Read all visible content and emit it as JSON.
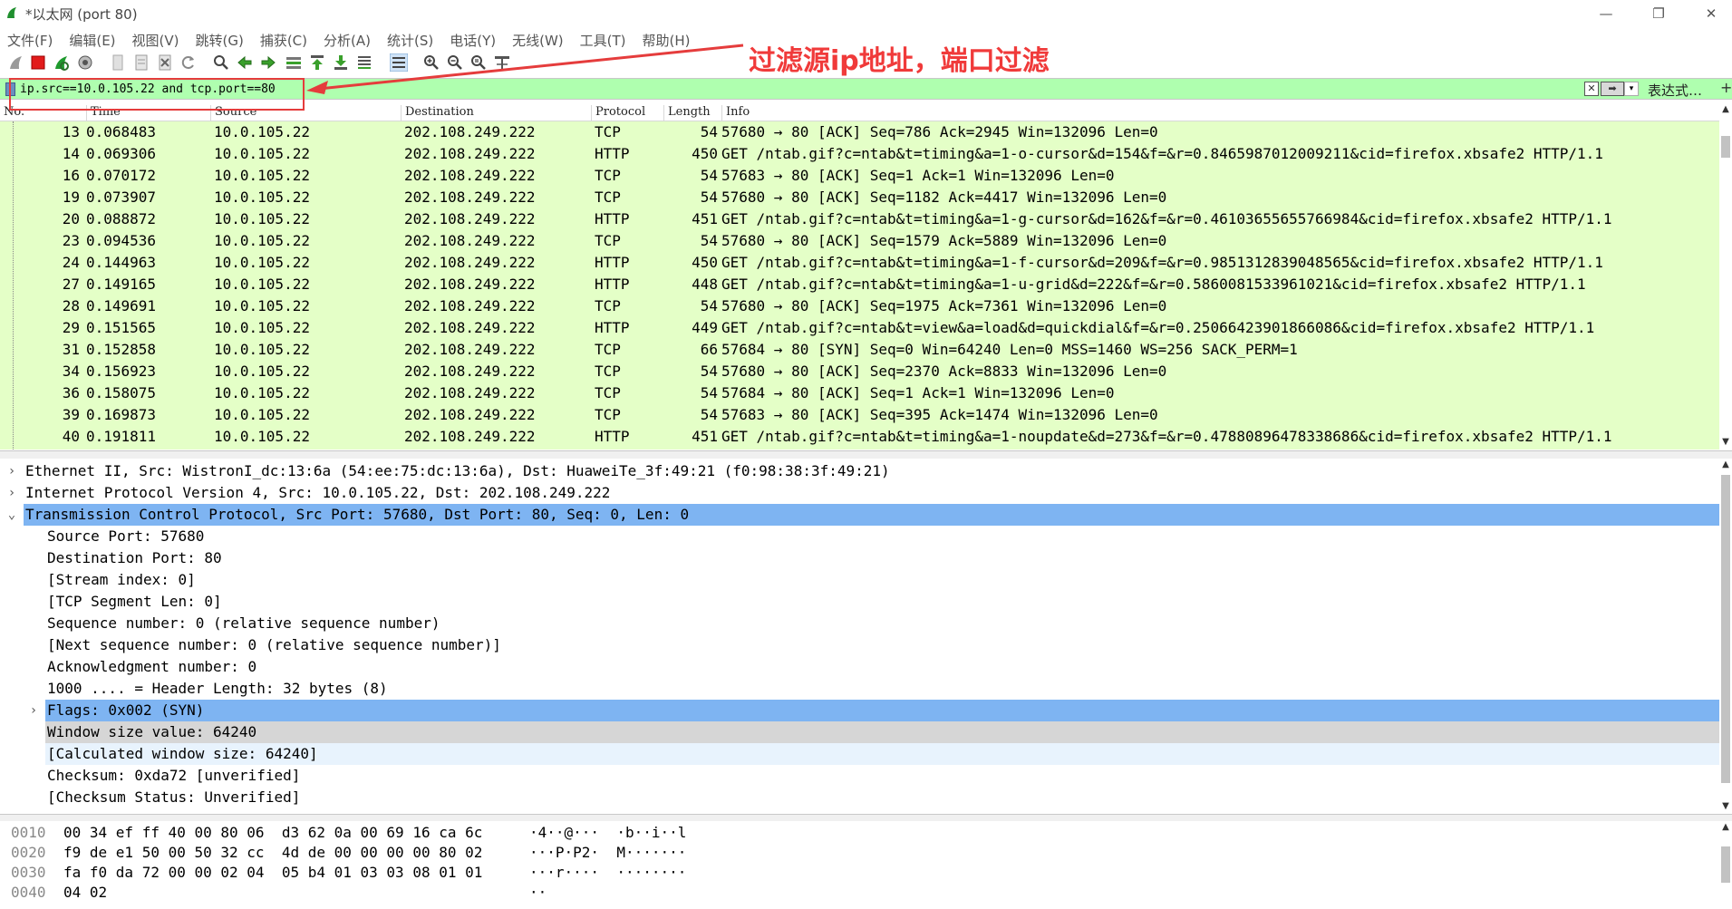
{
  "window": {
    "title": "*以太网 (port 80)",
    "minimize_glyph": "—",
    "maximize_glyph": "❐",
    "close_glyph": "✕"
  },
  "menu": [
    "文件(F)",
    "编辑(E)",
    "视图(V)",
    "跳转(G)",
    "捕获(C)",
    "分析(A)",
    "统计(S)",
    "电话(Y)",
    "无线(W)",
    "工具(T)",
    "帮助(H)"
  ],
  "toolbar": {
    "icons": [
      "shark-fin-start-icon",
      "stop-capture-icon",
      "restart-capture-icon",
      "capture-options-icon",
      "open-file-icon",
      "save-file-icon",
      "close-file-icon",
      "reload-file-icon",
      "find-packet-icon",
      "go-back-icon",
      "go-forward-icon",
      "go-to-packet-icon",
      "go-first-packet-icon",
      "go-last-packet-icon",
      "auto-scroll-icon",
      "colorize-icon",
      "zoom-in-icon",
      "zoom-out-icon",
      "zoom-normal-icon",
      "resize-columns-icon"
    ]
  },
  "filter": {
    "value": "ip.src==10.0.105.22 and tcp.port==80",
    "clear_glyph": "✕",
    "apply_glyph": "➡",
    "dropdown_glyph": "▾",
    "expression_label": "表达式…",
    "add_glyph": "+",
    "bg_color": "#afffaf"
  },
  "annotation": {
    "text": "过滤源ip地址，端口过滤",
    "color": "#f03a3a"
  },
  "packet_list": {
    "columns": [
      "No.",
      "Time",
      "Source",
      "Destination",
      "Protocol",
      "Length",
      "Info"
    ],
    "row_color": "#e4ffc7",
    "rows": [
      {
        "no": "13",
        "time": "0.068483",
        "src": "10.0.105.22",
        "dst": "202.108.249.222",
        "proto": "TCP",
        "len": "54",
        "info": "57680 → 80 [ACK] Seq=786 Ack=2945 Win=132096 Len=0"
      },
      {
        "no": "14",
        "time": "0.069306",
        "src": "10.0.105.22",
        "dst": "202.108.249.222",
        "proto": "HTTP",
        "len": "450",
        "info": "GET /ntab.gif?c=ntab&t=timing&a=1-o-cursor&d=154&f=&r=0.8465987012009211&cid=firefox.xbsafe2 HTTP/1.1"
      },
      {
        "no": "16",
        "time": "0.070172",
        "src": "10.0.105.22",
        "dst": "202.108.249.222",
        "proto": "TCP",
        "len": "54",
        "info": "57683 → 80 [ACK] Seq=1 Ack=1 Win=132096 Len=0"
      },
      {
        "no": "19",
        "time": "0.073907",
        "src": "10.0.105.22",
        "dst": "202.108.249.222",
        "proto": "TCP",
        "len": "54",
        "info": "57680 → 80 [ACK] Seq=1182 Ack=4417 Win=132096 Len=0"
      },
      {
        "no": "20",
        "time": "0.088872",
        "src": "10.0.105.22",
        "dst": "202.108.249.222",
        "proto": "HTTP",
        "len": "451",
        "info": "GET /ntab.gif?c=ntab&t=timing&a=1-g-cursor&d=162&f=&r=0.46103655655766984&cid=firefox.xbsafe2 HTTP/1.1"
      },
      {
        "no": "23",
        "time": "0.094536",
        "src": "10.0.105.22",
        "dst": "202.108.249.222",
        "proto": "TCP",
        "len": "54",
        "info": "57680 → 80 [ACK] Seq=1579 Ack=5889 Win=132096 Len=0"
      },
      {
        "no": "24",
        "time": "0.144963",
        "src": "10.0.105.22",
        "dst": "202.108.249.222",
        "proto": "HTTP",
        "len": "450",
        "info": "GET /ntab.gif?c=ntab&t=timing&a=1-f-cursor&d=209&f=&r=0.9851312839048565&cid=firefox.xbsafe2 HTTP/1.1"
      },
      {
        "no": "27",
        "time": "0.149165",
        "src": "10.0.105.22",
        "dst": "202.108.249.222",
        "proto": "HTTP",
        "len": "448",
        "info": "GET /ntab.gif?c=ntab&t=timing&a=1-u-grid&d=222&f=&r=0.5860081533961021&cid=firefox.xbsafe2 HTTP/1.1"
      },
      {
        "no": "28",
        "time": "0.149691",
        "src": "10.0.105.22",
        "dst": "202.108.249.222",
        "proto": "TCP",
        "len": "54",
        "info": "57680 → 80 [ACK] Seq=1975 Ack=7361 Win=132096 Len=0"
      },
      {
        "no": "29",
        "time": "0.151565",
        "src": "10.0.105.22",
        "dst": "202.108.249.222",
        "proto": "HTTP",
        "len": "449",
        "info": "GET /ntab.gif?c=ntab&t=view&a=load&d=quickdial&f=&r=0.25066423901866086&cid=firefox.xbsafe2 HTTP/1.1"
      },
      {
        "no": "31",
        "time": "0.152858",
        "src": "10.0.105.22",
        "dst": "202.108.249.222",
        "proto": "TCP",
        "len": "66",
        "info": "57684 → 80 [SYN] Seq=0 Win=64240 Len=0 MSS=1460 WS=256 SACK_PERM=1"
      },
      {
        "no": "34",
        "time": "0.156923",
        "src": "10.0.105.22",
        "dst": "202.108.249.222",
        "proto": "TCP",
        "len": "54",
        "info": "57680 → 80 [ACK] Seq=2370 Ack=8833 Win=132096 Len=0"
      },
      {
        "no": "36",
        "time": "0.158075",
        "src": "10.0.105.22",
        "dst": "202.108.249.222",
        "proto": "TCP",
        "len": "54",
        "info": "57684 → 80 [ACK] Seq=1 Ack=1 Win=132096 Len=0"
      },
      {
        "no": "39",
        "time": "0.169873",
        "src": "10.0.105.22",
        "dst": "202.108.249.222",
        "proto": "TCP",
        "len": "54",
        "info": "57683 → 80 [ACK] Seq=395 Ack=1474 Win=132096 Len=0"
      },
      {
        "no": "40",
        "time": "0.191811",
        "src": "10.0.105.22",
        "dst": "202.108.249.222",
        "proto": "HTTP",
        "len": "451",
        "info": "GET /ntab.gif?c=ntab&t=timing&a=1-noupdate&d=273&f=&r=0.47880896478338686&cid=firefox.xbsafe2 HTTP/1.1"
      }
    ]
  },
  "details": {
    "selected_color": "#7eb4f2",
    "hover_color": "#d6d6d6",
    "light_color": "#e8f3fd",
    "rows": [
      {
        "text": "Ethernet II, Src: WistronI_dc:13:6a (54:ee:75:dc:13:6a), Dst: HuaweiTe_3f:49:21 (f0:98:38:3f:49:21)",
        "arrow": "›",
        "indent": 0,
        "state": "normal"
      },
      {
        "text": "Internet Protocol Version 4, Src: 10.0.105.22, Dst: 202.108.249.222",
        "arrow": "›",
        "indent": 0,
        "state": "normal"
      },
      {
        "text": "Transmission Control Protocol, Src Port: 57680, Dst Port: 80, Seq: 0, Len: 0",
        "arrow": "⌄",
        "indent": 0,
        "state": "selected"
      },
      {
        "text": "Source Port: 57680",
        "arrow": "",
        "indent": 1,
        "state": "normal"
      },
      {
        "text": "Destination Port: 80",
        "arrow": "",
        "indent": 1,
        "state": "normal"
      },
      {
        "text": "[Stream index: 0]",
        "arrow": "",
        "indent": 1,
        "state": "normal"
      },
      {
        "text": "[TCP Segment Len: 0]",
        "arrow": "",
        "indent": 1,
        "state": "normal"
      },
      {
        "text": "Sequence number: 0    (relative sequence number)",
        "arrow": "",
        "indent": 1,
        "state": "normal"
      },
      {
        "text": "[Next sequence number: 0    (relative sequence number)]",
        "arrow": "",
        "indent": 1,
        "state": "normal"
      },
      {
        "text": "Acknowledgment number: 0",
        "arrow": "",
        "indent": 1,
        "state": "normal"
      },
      {
        "text": "1000 .... = Header Length: 32 bytes (8)",
        "arrow": "",
        "indent": 1,
        "state": "normal"
      },
      {
        "text": "Flags: 0x002 (SYN)",
        "arrow": "›",
        "indent": 1,
        "state": "selected"
      },
      {
        "text": "Window size value: 64240",
        "arrow": "",
        "indent": 1,
        "state": "hover"
      },
      {
        "text": "[Calculated window size: 64240]",
        "arrow": "",
        "indent": 1,
        "state": "light"
      },
      {
        "text": "Checksum: 0xda72 [unverified]",
        "arrow": "",
        "indent": 1,
        "state": "normal"
      },
      {
        "text": "[Checksum Status: Unverified]",
        "arrow": "",
        "indent": 1,
        "state": "normal"
      }
    ]
  },
  "hex": {
    "rows": [
      {
        "offset": "0010",
        "bytes": "00 34 ef ff 40 00 80 06  d3 62 0a 00 69 16 ca 6c",
        "ascii": "·4··@···  ·b··i··l"
      },
      {
        "offset": "0020",
        "bytes": "f9 de e1 50 00 50 32 cc  4d de 00 00 00 00 80 02",
        "ascii": "···P·P2·  M·······"
      },
      {
        "offset": "0030",
        "bytes": "fa f0 da 72 00 00 02 04  05 b4 01 03 03 08 01 01",
        "ascii": "···r····  ········"
      },
      {
        "offset": "0040",
        "bytes": "04 02",
        "ascii": "··"
      }
    ]
  }
}
